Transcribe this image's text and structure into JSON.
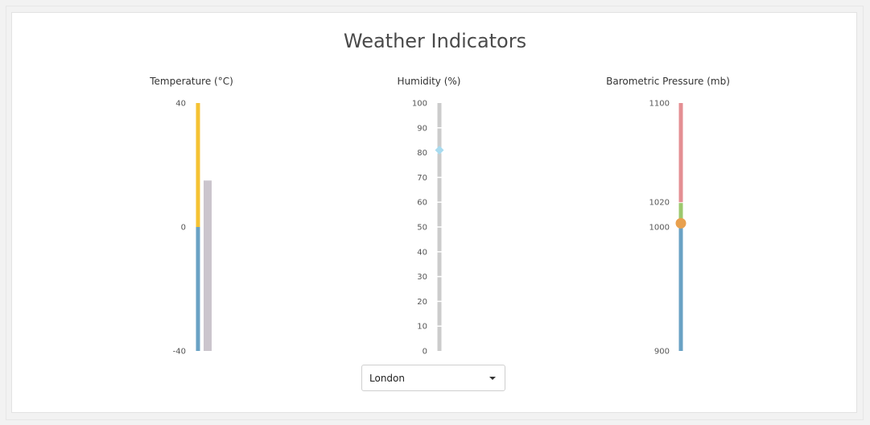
{
  "title": "Weather Indicators",
  "city_select": {
    "value": "London"
  },
  "colors": {
    "temp_warm": "#f5c233",
    "temp_cold": "#6aa2c4",
    "temp_value": "#cbc5cd",
    "humidity_track": "#cccccc",
    "humidity_marker": "#a8dbef",
    "pressure_high": "#e48f93",
    "pressure_mid": "#9cc86e",
    "pressure_low": "#6aa2c4",
    "pressure_marker": "#e8a04e"
  },
  "chart_data": [
    {
      "type": "linear-gauge",
      "title": "Temperature (°C)",
      "range": [
        -40,
        40
      ],
      "tick_labels": [
        "40",
        "0",
        "-40"
      ],
      "bands": [
        {
          "from": 0,
          "to": 40,
          "color": "#f5c233"
        },
        {
          "from": -40,
          "to": 0,
          "color": "#6aa2c4"
        }
      ],
      "value": 15,
      "indicator": "bar"
    },
    {
      "type": "linear-gauge",
      "title": "Humidity (%)",
      "range": [
        0,
        100
      ],
      "tick_labels": [
        "100",
        "90",
        "80",
        "70",
        "60",
        "50",
        "40",
        "30",
        "20",
        "10",
        "0"
      ],
      "value": 81,
      "indicator": "diamond"
    },
    {
      "type": "linear-gauge",
      "title": "Barometric Pressure (mb)",
      "range": [
        900,
        1100
      ],
      "tick_labels": [
        "1100",
        "1020",
        "1000",
        "900"
      ],
      "bands": [
        {
          "from": 1020,
          "to": 1100,
          "color": "#e48f93"
        },
        {
          "from": 1000,
          "to": 1020,
          "color": "#9cc86e"
        },
        {
          "from": 900,
          "to": 1000,
          "color": "#6aa2c4"
        }
      ],
      "value": 1003,
      "indicator": "circle"
    }
  ]
}
